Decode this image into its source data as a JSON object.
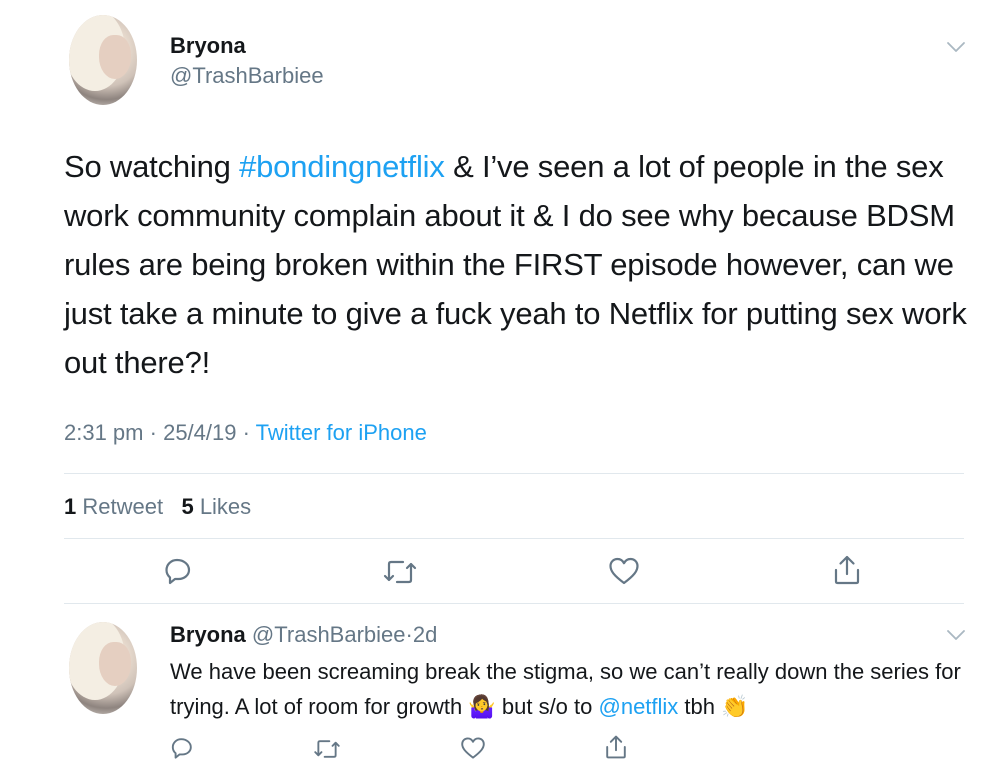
{
  "main_tweet": {
    "author_name": "Bryona",
    "handle": "@TrashBarbiee",
    "text_before_tag": "So watching ",
    "hashtag": "#bondingnetflix",
    "text_after_tag": " & I’ve seen a lot of people in the sex work community complain about it & I do see why because BDSM rules are being broken within the FIRST episode however, can we just take a minute to give a fuck yeah to Netflix for putting sex work out there?!",
    "time": "2:31 pm",
    "date": "25/4/19",
    "separator": "·",
    "source": "Twitter for iPhone",
    "retweets_count": "1",
    "retweets_label": "Retweet",
    "likes_count": "5",
    "likes_label": "Likes"
  },
  "reply_tweet": {
    "author_name": "Bryona",
    "handle": "@TrashBarbiee",
    "separator": "·",
    "age": "2d",
    "text_part1": "We have been screaming break the stigma, so we can’t really down the series for trying. A lot of room for growth ",
    "emoji1": "🤷‍♀️",
    "text_part2": " but s/o to ",
    "mention": "@netflix",
    "text_part3": " tbh ",
    "emoji2": "👏"
  },
  "icons": {
    "menu": "chevron-down-icon",
    "reply": "reply-icon",
    "retweet": "retweet-icon",
    "like": "heart-icon",
    "share": "share-icon"
  },
  "colors": {
    "link": "#1da1f2",
    "muted": "#657786",
    "divider": "#e1e8ed",
    "text": "#14171a"
  }
}
